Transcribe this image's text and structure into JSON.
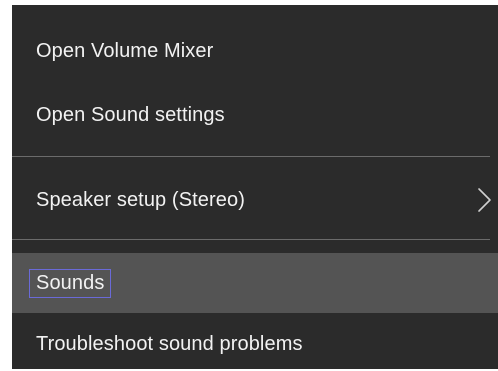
{
  "context_menu": {
    "items": [
      {
        "label": "Open Volume Mixer"
      },
      {
        "label": "Open Sound settings"
      },
      {
        "label": "Speaker setup (Stereo)",
        "submenu_icon": "chevron-right-icon"
      },
      {
        "label": "Sounds",
        "state": "hover-focused"
      },
      {
        "label": "Troubleshoot sound problems"
      }
    ]
  },
  "colors": {
    "menu_background": "#2b2b2b",
    "hover_background": "#545454",
    "text": "#f2f2f2",
    "separator": "#6b6b6b",
    "focus_outline": "#6a6ad8"
  }
}
